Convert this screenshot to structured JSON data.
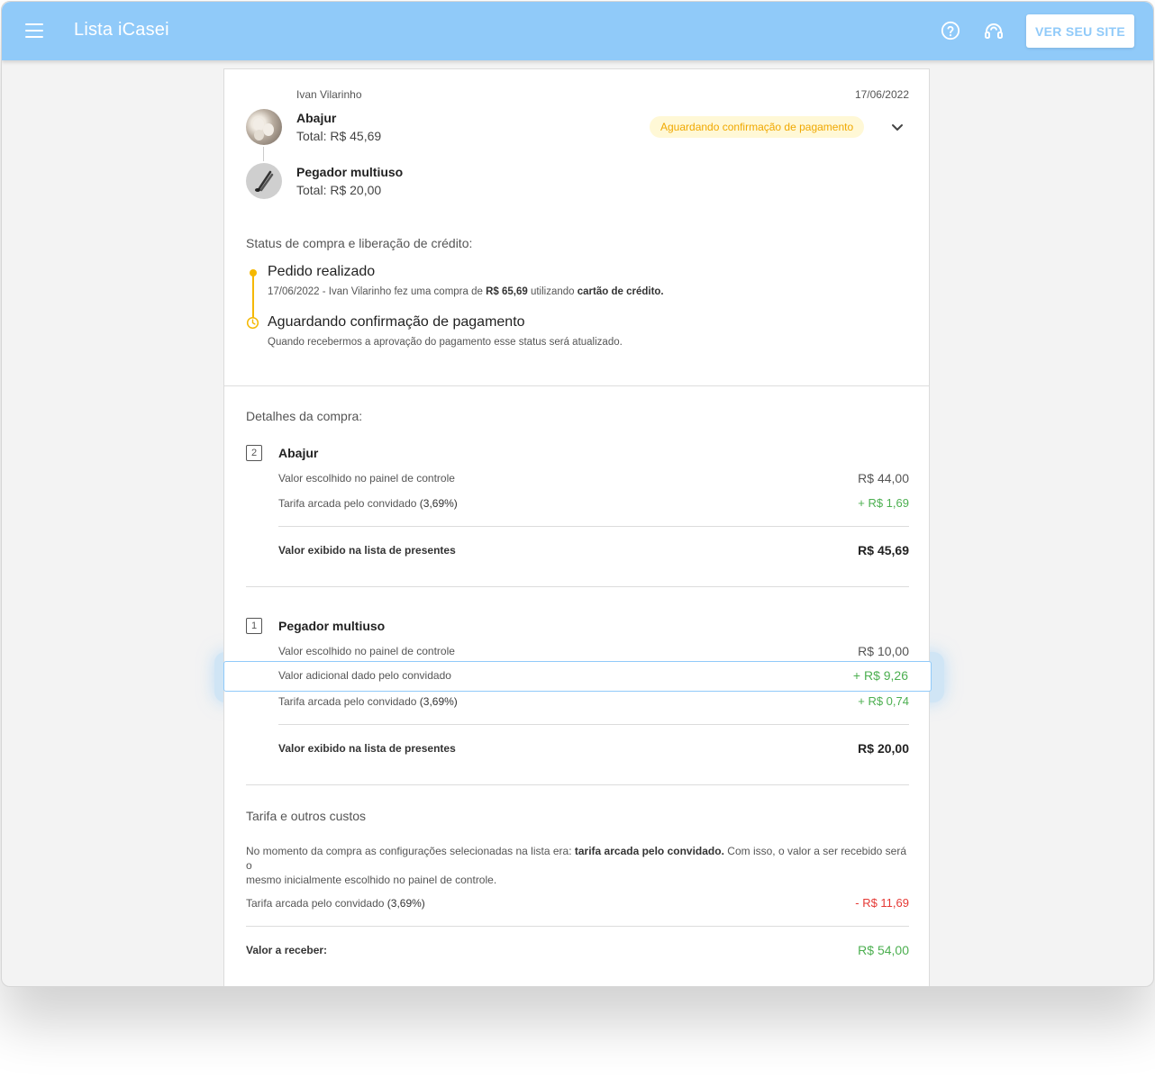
{
  "app": {
    "title": "Lista iCasei",
    "site_button": "VER SEU SITE"
  },
  "order": {
    "buyer": "Ivan Vilarinho",
    "date": "17/06/2022",
    "status_badge": "Aguardando confirmação de pagamento",
    "items": [
      {
        "name": "Abajur",
        "total": "Total: R$ 45,69"
      },
      {
        "name": "Pegador multiuso",
        "total": "Total: R$ 20,00"
      }
    ]
  },
  "status": {
    "heading": "Status de compra e liberação de crédito:",
    "steps": [
      {
        "title": "Pedido realizado",
        "desc_prefix": "17/06/2022 - Ivan Vilarinho fez uma compra de ",
        "desc_amount": "R$ 65,69",
        "desc_middle": " utilizando ",
        "desc_method": "cartão de crédito."
      },
      {
        "title": "Aguardando confirmação de pagamento",
        "desc": "Quando recebermos a aprovação do pagamento esse status será atualizado."
      }
    ]
  },
  "details": {
    "heading": "Detalhes da compra:",
    "products": [
      {
        "qty": "2",
        "name": "Abajur",
        "rows": [
          {
            "label": "Valor escolhido no painel de controle",
            "value": "R$ 44,00"
          },
          {
            "label": "Tarifa arcada pelo convidado ",
            "label_strong": "(3,69%)",
            "value": "+ R$ 1,69"
          }
        ],
        "total_label": "Valor exibido na lista de presentes",
        "total_value": "R$ 45,69"
      },
      {
        "qty": "1",
        "name": "Pegador multiuso",
        "rows": [
          {
            "label": "Valor escolhido no painel de controle",
            "value": "R$ 10,00"
          },
          {
            "label": "Valor adicional dado pelo convidado",
            "value": "+ R$ 9,26"
          },
          {
            "label": "Tarifa arcada pelo convidado ",
            "label_strong": "(3,69%)",
            "value": "+ R$ 0,74"
          }
        ],
        "total_label": "Valor exibido na lista de presentes",
        "total_value": "R$ 20,00"
      }
    ]
  },
  "fees": {
    "heading": "Tarifa e outros custos",
    "note_prefix": "No momento da compra as configurações selecionadas na lista era: ",
    "note_strong": "tarifa arcada pelo convidado.",
    "note_line1_suffix": " Com isso, o valor a ser recebido será o",
    "note_line2": "mesmo inicialmente escolhido no painel de controle.",
    "fee_label": "Tarifa arcada pelo convidado ",
    "fee_label_strong": "(3,69%)",
    "fee_value": "- R$ 11,69",
    "receive_label": "Valor a receber:",
    "receive_value": "R$ 54,00"
  },
  "colors": {
    "header": "#90caf9",
    "accent_yellow": "#f5b800",
    "positive": "#4caf50",
    "negative": "#e53935"
  },
  "icons": {
    "menu": "hamburger-menu-icon",
    "help": "help-circle-icon",
    "support": "headset-icon",
    "expand": "chevron-down-icon",
    "pending": "clock-icon"
  }
}
